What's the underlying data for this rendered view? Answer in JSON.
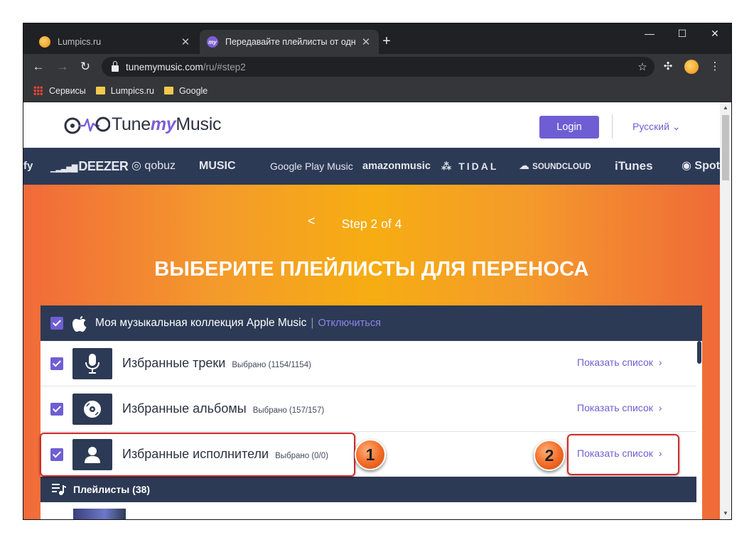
{
  "browser": {
    "tabs": [
      {
        "title": "Lumpics.ru",
        "favicon": "lumpics-favicon-icon",
        "active": false
      },
      {
        "title": "Передавайте плейлисты от одн",
        "favicon": "tunemymusic-favicon-icon",
        "active": true
      }
    ],
    "url_host": "tunemymusic.com",
    "url_path": "/ru/#step2",
    "bookmarks": [
      "Сервисы",
      "Lumpics.ru",
      "Google"
    ]
  },
  "site": {
    "logo_text_a": "Tune",
    "logo_text_b": "my",
    "logo_text_c": "Music",
    "login_label": "Login",
    "language": "Русский",
    "accent": "#6f5ed3",
    "navy": "#2c3a55",
    "services": [
      "fy",
      "DEEZER",
      "qobuz",
      "MUSIC",
      "Google Play Music",
      "amazonmusic",
      "TIDAL",
      "SOUNDCLOUD",
      "iTunes",
      "Spot"
    ]
  },
  "hero": {
    "step": "Step 2 of 4",
    "heading": "ВЫБЕРИТЕ ПЛЕЙЛИСТЫ ДЛЯ ПЕРЕНОСА"
  },
  "collection": {
    "title": "Моя музыкальная коллекция Apple Music",
    "separator": "|",
    "disconnect": "Отключиться",
    "rows": [
      {
        "name": "Избранные треки",
        "selected": "Выбрано (1154/1154)",
        "show": "Показать список",
        "icon": "microphone-icon"
      },
      {
        "name": "Избранные альбомы",
        "selected": "Выбрано (157/157)",
        "show": "Показать список",
        "icon": "vinyl-disc-icon"
      },
      {
        "name": "Избранные исполнители",
        "selected": "Выбрано (0/0)",
        "show": "Показать список",
        "icon": "person-icon"
      }
    ],
    "playlists_title": "Плейлисты (38)"
  },
  "annotations": {
    "badge1": "1",
    "badge2": "2",
    "color": "#d32a2a"
  }
}
